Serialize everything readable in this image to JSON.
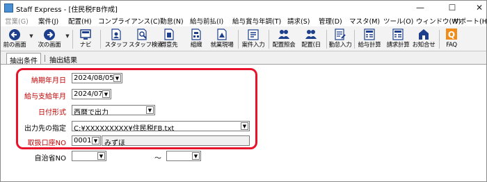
{
  "window": {
    "title": "Staff Express - [住民税FB作成]",
    "controls": {
      "minimize": "—",
      "maximize": "☐",
      "close": "✕"
    }
  },
  "menu": [
    {
      "label": "営業(G)",
      "disabled": true
    },
    {
      "label": "案件(J)",
      "disabled": false
    },
    {
      "label": "配置(H)",
      "disabled": false
    },
    {
      "label": "コンプライアンス(C)",
      "disabled": false
    },
    {
      "label": "勤怠(N)",
      "disabled": false
    },
    {
      "label": "給与前払(I)",
      "disabled": false
    },
    {
      "label": "給与賞与年調(T)",
      "disabled": false
    },
    {
      "label": "請求(S)",
      "disabled": false
    },
    {
      "label": "管理(D)",
      "disabled": false
    },
    {
      "label": "マスタ(M)",
      "disabled": false
    },
    {
      "label": "ツール(O)",
      "disabled": false
    },
    {
      "label": "ウィンドウ(W)",
      "disabled": false
    },
    {
      "label": "サポート(H)",
      "disabled": false
    }
  ],
  "toolbar": [
    {
      "label": "前の画面",
      "icon": "back-arrow-icon"
    },
    {
      "label": "次の画面",
      "icon": "forward-arrow-icon"
    },
    {
      "label": "ナビ",
      "icon": "navi-icon"
    },
    {
      "label": "スタッフ",
      "icon": "staff-icon"
    },
    {
      "label": "スタッフ検索",
      "icon": "staff-search-icon"
    },
    {
      "label": "得意先",
      "icon": "customer-icon"
    },
    {
      "label": "組織",
      "icon": "organization-icon"
    },
    {
      "label": "就業現場",
      "icon": "workplace-icon"
    },
    {
      "label": "案件入力",
      "icon": "job-entry-icon"
    },
    {
      "label": "配置照会",
      "icon": "placement-inquiry-icon"
    },
    {
      "label": "配置(日",
      "icon": "placement-daily-icon"
    },
    {
      "label": "勤怠入力",
      "icon": "attendance-entry-icon"
    },
    {
      "label": "給与計算",
      "icon": "payroll-icon"
    },
    {
      "label": "請求計算",
      "icon": "billing-icon"
    },
    {
      "label": "お知合せ",
      "icon": "notice-icon"
    },
    {
      "label": "FAQ",
      "icon": "faq-icon"
    }
  ],
  "tabs": {
    "active": "抽出条件",
    "inactive": "抽出結果"
  },
  "form": {
    "delivery_date": {
      "label": "納期年月日",
      "value": "2024/08/05"
    },
    "pay_month": {
      "label": "給与支給年月",
      "value": "2024/07"
    },
    "date_format": {
      "label": "日付形式",
      "value": "西暦で出力"
    },
    "output_path": {
      "label": "出力先の指定",
      "value": "C:¥XXXXXXXXX¥住民税FB.txt"
    },
    "account": {
      "label": "取扱口座NO",
      "code": "0001",
      "name": "みずほ"
    },
    "municipality": {
      "label": "自治省NO",
      "from": "",
      "separator": "～",
      "to": ""
    }
  },
  "colors": {
    "required_label": "#c00000",
    "highlight_border": "#e8132b"
  }
}
